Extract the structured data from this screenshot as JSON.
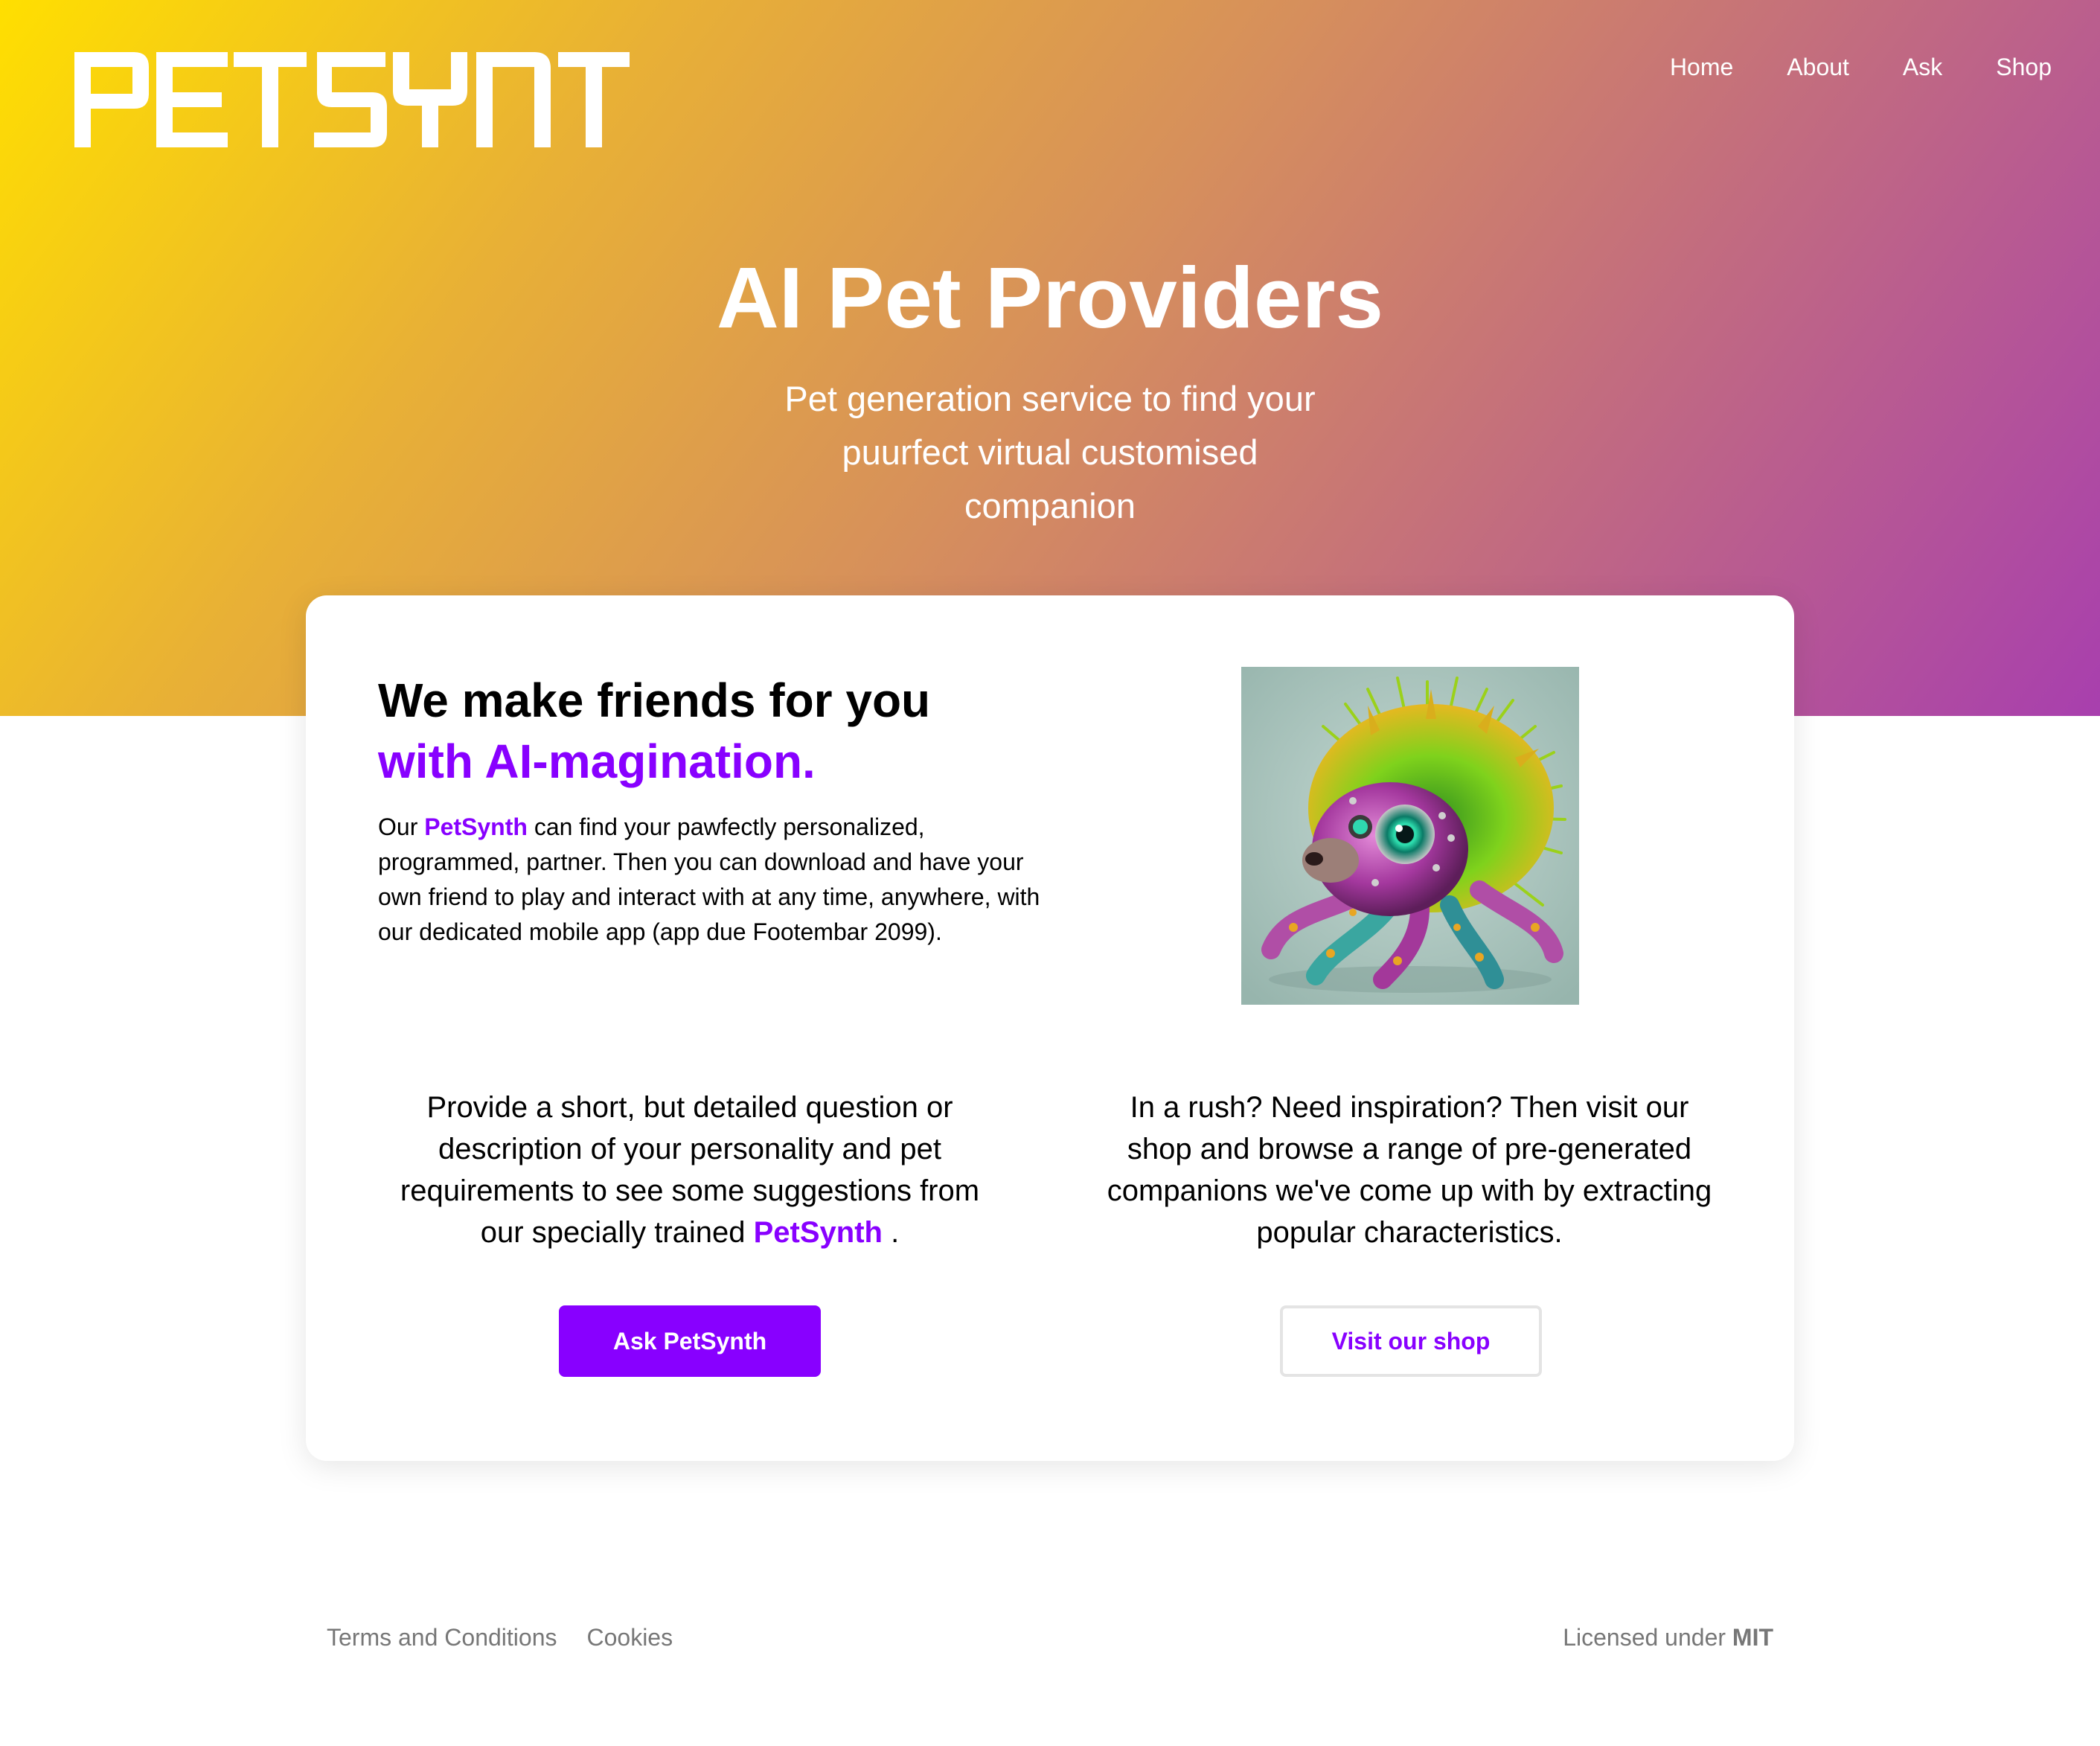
{
  "brand": {
    "logo_text": "PETSYNTH",
    "name": "PetSynth"
  },
  "nav": {
    "items": [
      {
        "label": "Home"
      },
      {
        "label": "About"
      },
      {
        "label": "Ask"
      },
      {
        "label": "Shop"
      }
    ]
  },
  "hero": {
    "title": "AI Pet Providers",
    "subtitle": "Pet generation service to find your puurfect virtual customised companion"
  },
  "intro": {
    "heading_line1": "We make friends for you",
    "heading_line2": "with AI-magination.",
    "text_before": "Our ",
    "text_after": " can find your pawfectly personalized, programmed, partner. Then you can download and have your own friend to play and interact with at any time, anywhere, with our dedicated mobile app (app due Footembar 2099)."
  },
  "ask_section": {
    "text_before": "Provide a short, but detailed question or description of your personality and pet requirements to see some suggestions from our specially trained ",
    "text_after": " .",
    "button_label": "Ask PetSynth"
  },
  "shop_section": {
    "text": "In a rush? Need inspiration? Then visit our shop and browse a range of pre-generated companions we've come up with by extracting popular characteristics.",
    "button_label": "Visit our shop"
  },
  "footer": {
    "links": [
      {
        "label": "Terms and Conditions"
      },
      {
        "label": "Cookies"
      }
    ],
    "license_prefix": "Licensed under ",
    "license_name": "MIT"
  },
  "colors": {
    "accent": "#8800ff",
    "gradient_start": "#ffdf00",
    "gradient_end": "#a83fae",
    "footer_text": "#777777"
  },
  "images": {
    "pet": "pet-synth-creature-illustration"
  }
}
